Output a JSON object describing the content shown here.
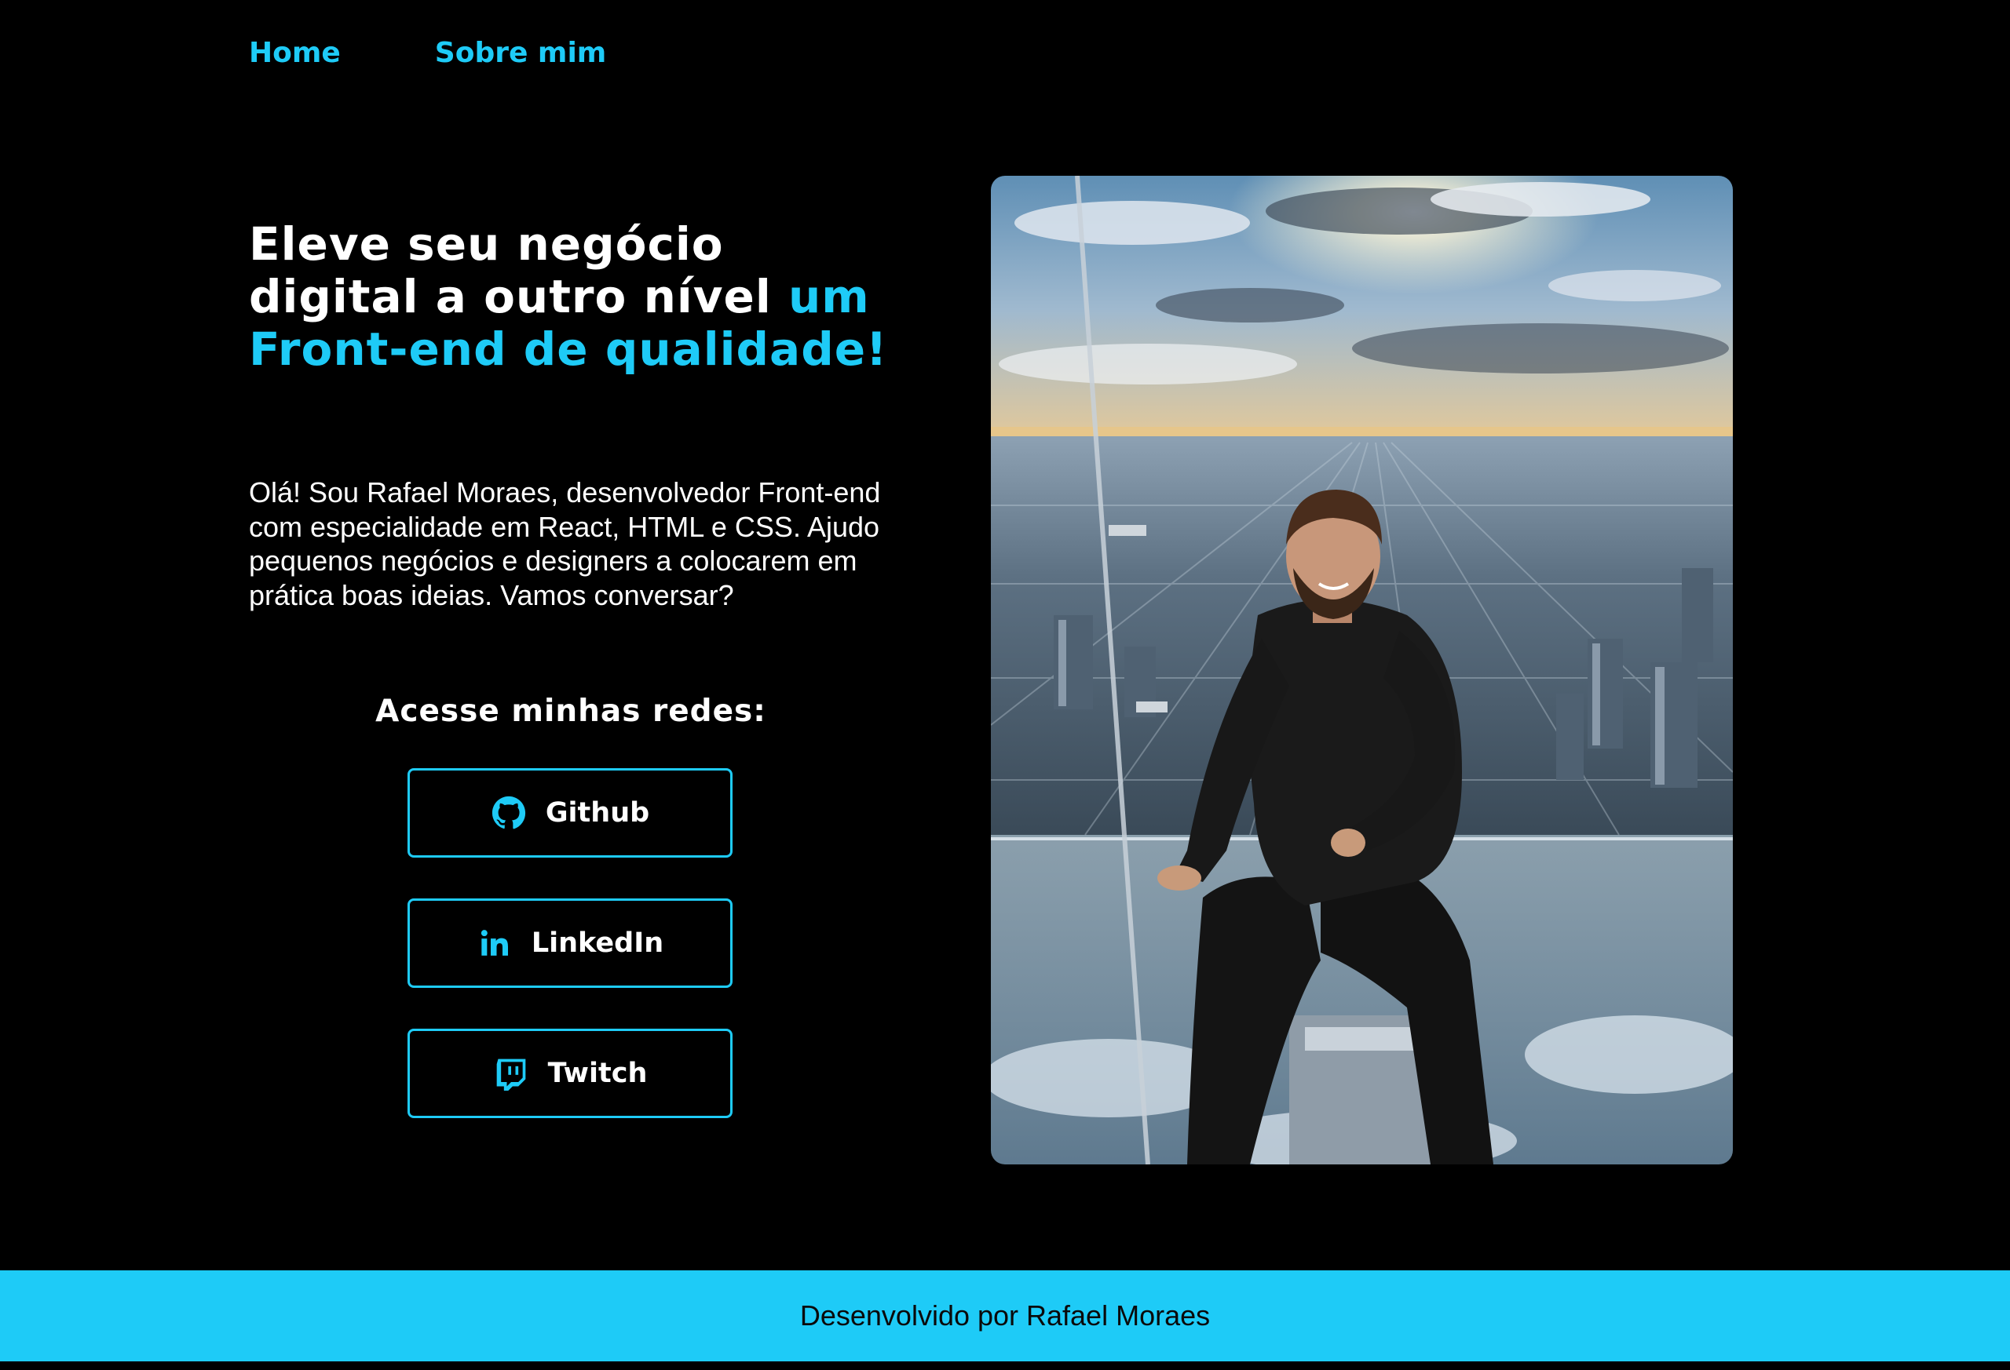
{
  "nav": {
    "items": [
      {
        "label": "Home"
      },
      {
        "label": "Sobre mim"
      }
    ]
  },
  "hero": {
    "headline_white": "Eleve seu negócio digital a outro nível",
    "headline_accent": "um Front-end de qualidade!",
    "intro": "Olá! Sou Rafael Moraes, desenvolvedor Front-end com especialidade em React, HTML e CSS. Ajudo pequenos negócios e designers a colocarem em prática boas ideias. Vamos conversar?",
    "social_title": "Acesse minhas redes:",
    "social": [
      {
        "label": "Github",
        "icon": "github-icon"
      },
      {
        "label": "LinkedIn",
        "icon": "linkedin-icon"
      },
      {
        "label": "Twitch",
        "icon": "twitch-icon"
      }
    ]
  },
  "footer": {
    "text": "Desenvolvido por Rafael Moraes"
  },
  "colors": {
    "background": "#000000",
    "accent": "#1ecbf7",
    "text": "#ffffff",
    "footer_text": "#0a0a0a"
  }
}
